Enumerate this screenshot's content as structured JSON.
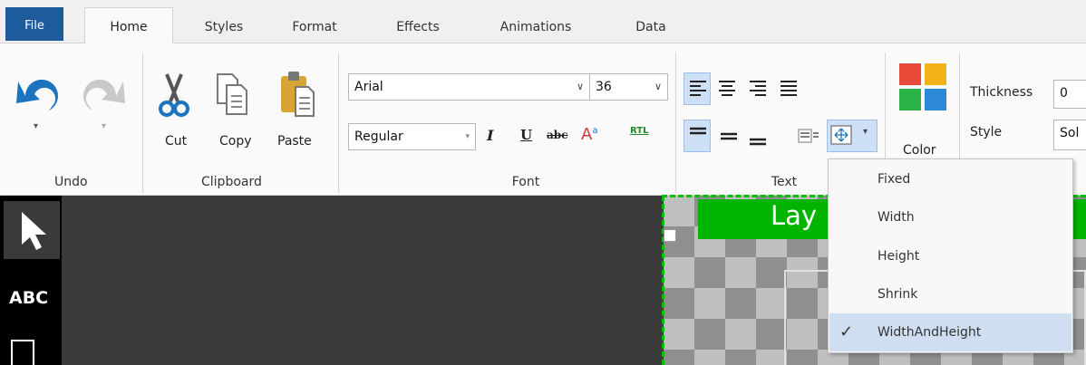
{
  "tabs": [
    {
      "label": "File"
    },
    {
      "label": "Home"
    },
    {
      "label": "Styles"
    },
    {
      "label": "Format"
    },
    {
      "label": "Effects"
    },
    {
      "label": "Animations"
    },
    {
      "label": "Data"
    }
  ],
  "groups": {
    "undo": {
      "label": "Undo"
    },
    "clipboard": {
      "label": "Clipboard",
      "cut": "Cut",
      "copy": "Copy",
      "paste": "Paste"
    },
    "font": {
      "label": "Font",
      "family": "Arial",
      "size": "36",
      "style": "Regular",
      "rtl": "RTL"
    },
    "text": {
      "label": "Text"
    },
    "color": {
      "label": "Color"
    },
    "line": {
      "thickness_label": "Thickness",
      "thickness_value": "0",
      "style_label": "Style",
      "style_value": "Sol"
    }
  },
  "canvas": {
    "tool_text": "ABC",
    "layer_text": "Lay"
  },
  "autosize_menu": {
    "items": [
      {
        "label": "Fixed",
        "checked": false
      },
      {
        "label": "Width",
        "checked": false
      },
      {
        "label": "Height",
        "checked": false
      },
      {
        "label": "Shrink",
        "checked": false
      },
      {
        "label": "WidthAndHeight",
        "checked": true
      }
    ],
    "check_mark": "✓"
  },
  "colors": {
    "file_tab": "#1e5b9c",
    "accent_green": "#00b400",
    "selection": "#cfdff1"
  }
}
